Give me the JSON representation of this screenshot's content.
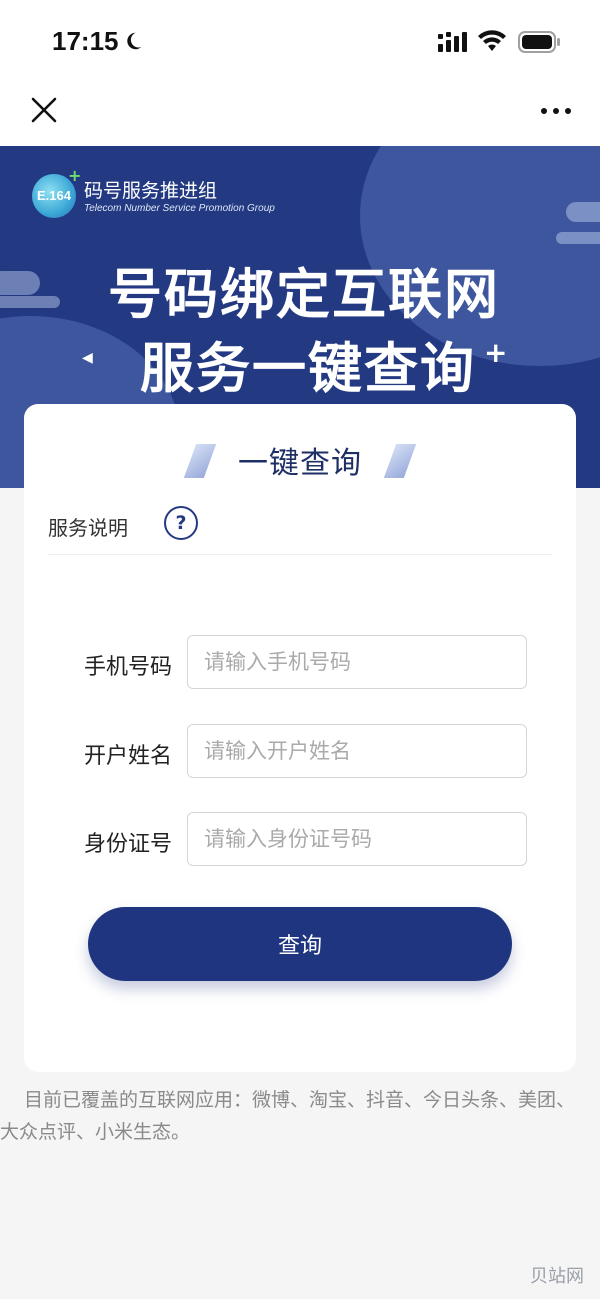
{
  "status_bar": {
    "time": "17:15",
    "icons": [
      "moon-icon",
      "signal-icon",
      "wifi-icon",
      "battery-icon"
    ]
  },
  "nav": {
    "close_icon": "close-icon",
    "more_icon": "more-icon"
  },
  "banner": {
    "logo_text": "E.164",
    "logo_title": "码号服务推进组",
    "logo_subtitle": "Telecom Number Service  Promotion Group",
    "title_line1": "号码绑定互联网",
    "title_line2": "服务一键查询",
    "bg_color": "#233a82"
  },
  "card": {
    "title": "一键查询",
    "help_label": "服务说明",
    "help_icon": "?",
    "fields": [
      {
        "label": "手机号码",
        "placeholder": "请输入手机号码",
        "value": ""
      },
      {
        "label": "开户姓名",
        "placeholder": "请输入开户姓名",
        "value": ""
      },
      {
        "label": "身份证号",
        "placeholder": "请输入身份证号码",
        "value": ""
      }
    ],
    "submit_label": "查询",
    "accent_color": "#1f3580"
  },
  "coverage_note": "目前已覆盖的互联网应用：微博、淘宝、抖音、今日头条、美团、大众点评、小米生态。",
  "watermark": "贝站网"
}
